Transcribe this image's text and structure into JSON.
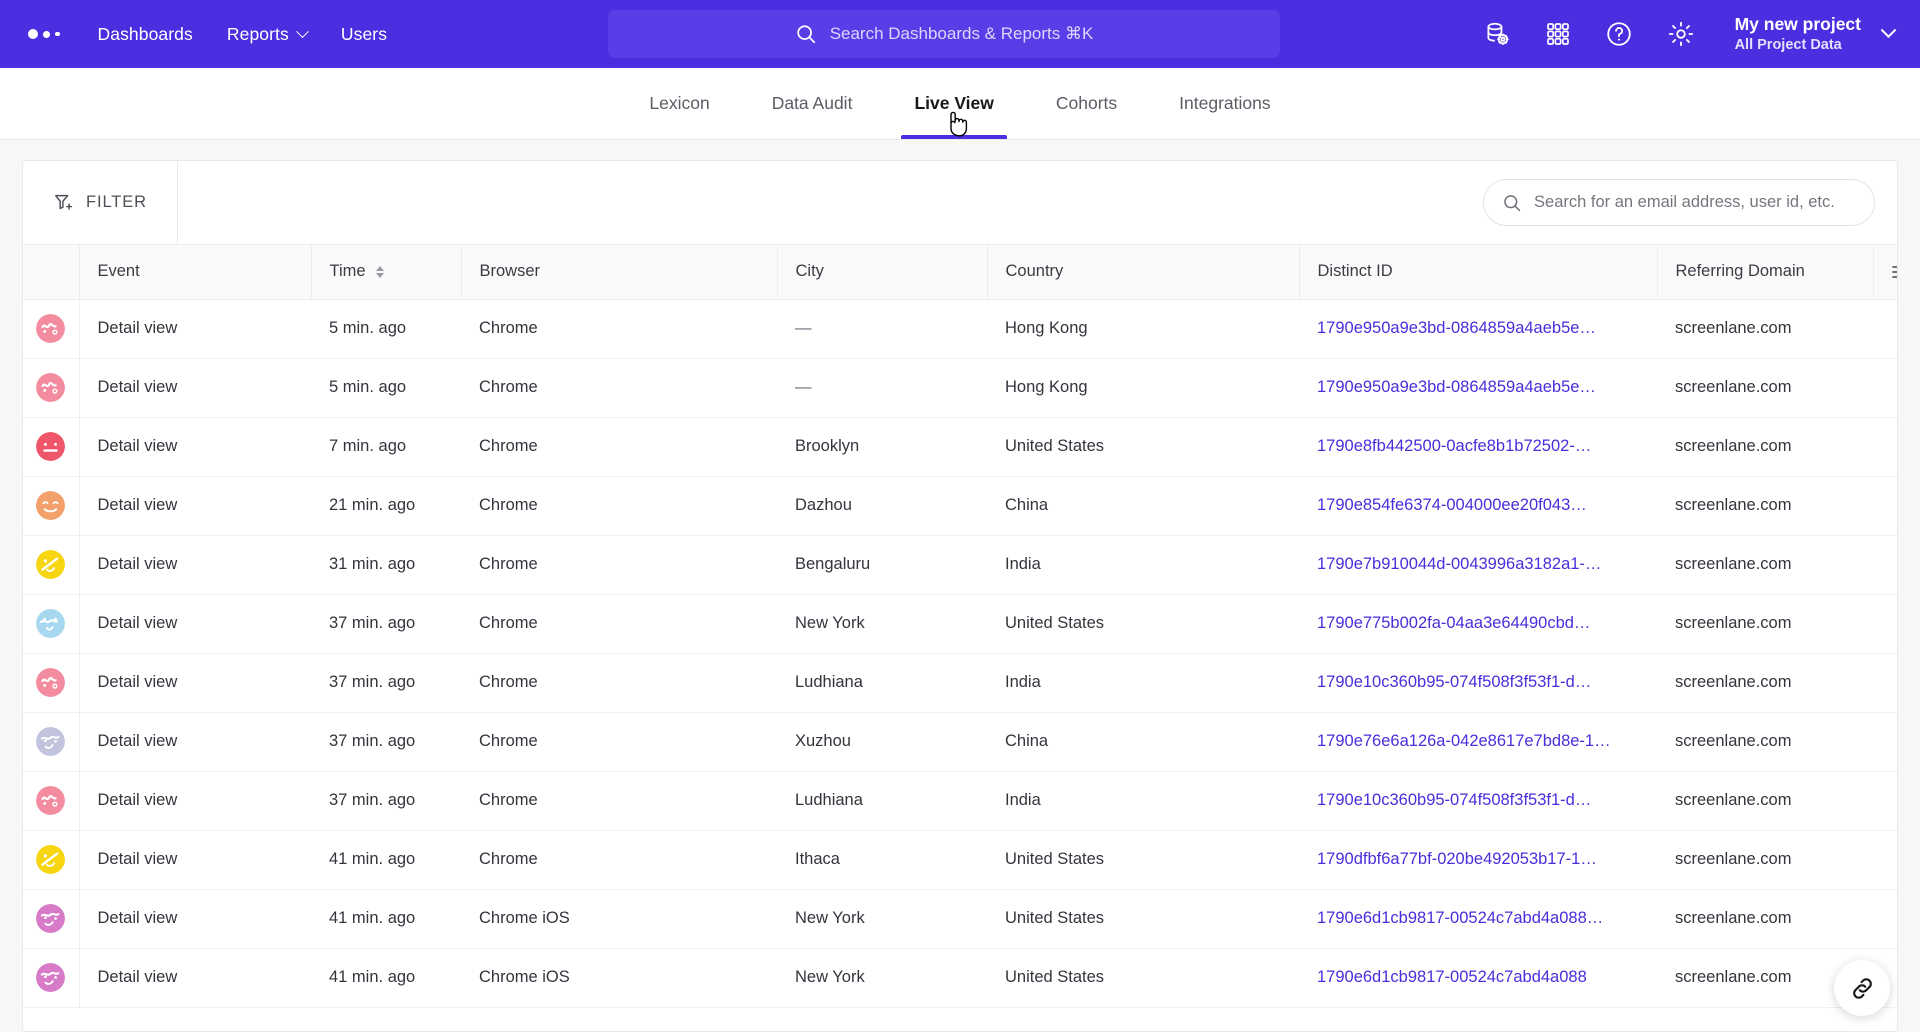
{
  "topnav": {
    "logo_name": "mixpanel-logo",
    "links": [
      {
        "label": "Dashboards",
        "has_caret": false
      },
      {
        "label": "Reports",
        "has_caret": true
      },
      {
        "label": "Users",
        "has_caret": false
      }
    ],
    "search_placeholder": "Search Dashboards & Reports ⌘K",
    "icons": [
      "database-gear-icon",
      "grid-apps-icon",
      "help-circle-icon",
      "gear-icon"
    ],
    "project": {
      "name": "My new project",
      "scope": "All Project Data"
    },
    "accent": "#4c2ee0"
  },
  "subtabs": {
    "items": [
      {
        "label": "Lexicon",
        "active": false
      },
      {
        "label": "Data Audit",
        "active": false
      },
      {
        "label": "Live View",
        "active": true
      },
      {
        "label": "Cohorts",
        "active": false
      },
      {
        "label": "Integrations",
        "active": false
      }
    ]
  },
  "toolbar": {
    "filter_label": "FILTER",
    "search_value": "",
    "search_placeholder": "Search for an email address, user id, etc."
  },
  "table": {
    "columns": [
      "Event",
      "Time",
      "Browser",
      "City",
      "Country",
      "Distinct ID",
      "Referring Domain"
    ],
    "sorted_column": "Time",
    "rows": [
      {
        "avatar": "#f48ca0",
        "event": "Detail view",
        "time": "5 min. ago",
        "browser": "Chrome",
        "city": "—",
        "country": "Hong Kong",
        "distinct_id": "1790e950a9e3bd-0864859a4aeb5e…",
        "referring_domain": "screenlane.com"
      },
      {
        "avatar": "#f48ca0",
        "event": "Detail view",
        "time": "5 min. ago",
        "browser": "Chrome",
        "city": "—",
        "country": "Hong Kong",
        "distinct_id": "1790e950a9e3bd-0864859a4aeb5e…",
        "referring_domain": "screenlane.com"
      },
      {
        "avatar": "#f0566a",
        "event": "Detail view",
        "time": "7 min. ago",
        "browser": "Chrome",
        "city": "Brooklyn",
        "country": "United States",
        "distinct_id": "1790e8fb442500-0acfe8b1b72502-…",
        "referring_domain": "screenlane.com"
      },
      {
        "avatar": "#f3a06a",
        "event": "Detail view",
        "time": "21 min. ago",
        "browser": "Chrome",
        "city": "Dazhou",
        "country": "China",
        "distinct_id": "1790e854fe6374-004000ee20f043…",
        "referring_domain": "screenlane.com"
      },
      {
        "avatar": "#f7d510",
        "event": "Detail view",
        "time": "31 min. ago",
        "browser": "Chrome",
        "city": "Bengaluru",
        "country": "India",
        "distinct_id": "1790e7b910044d-0043996a3182a1-…",
        "referring_domain": "screenlane.com"
      },
      {
        "avatar": "#a8d8ef",
        "event": "Detail view",
        "time": "37 min. ago",
        "browser": "Chrome",
        "city": "New York",
        "country": "United States",
        "distinct_id": "1790e775b002fa-04aa3e64490cbd…",
        "referring_domain": "screenlane.com"
      },
      {
        "avatar": "#f48ca0",
        "event": "Detail view",
        "time": "37 min. ago",
        "browser": "Chrome",
        "city": "Ludhiana",
        "country": "India",
        "distinct_id": "1790e10c360b95-074f508f3f53f1-d…",
        "referring_domain": "screenlane.com"
      },
      {
        "avatar": "#c2c3dd",
        "event": "Detail view",
        "time": "37 min. ago",
        "browser": "Chrome",
        "city": "Xuzhou",
        "country": "China",
        "distinct_id": "1790e76e6a126a-042e8617e7bd8e-1…",
        "referring_domain": "screenlane.com"
      },
      {
        "avatar": "#f48ca0",
        "event": "Detail view",
        "time": "37 min. ago",
        "browser": "Chrome",
        "city": "Ludhiana",
        "country": "India",
        "distinct_id": "1790e10c360b95-074f508f3f53f1-d…",
        "referring_domain": "screenlane.com"
      },
      {
        "avatar": "#f7d510",
        "event": "Detail view",
        "time": "41 min. ago",
        "browser": "Chrome",
        "city": "Ithaca",
        "country": "United States",
        "distinct_id": "1790dfbf6a77bf-020be492053b17-1…",
        "referring_domain": "screenlane.com"
      },
      {
        "avatar": "#d77ac8",
        "event": "Detail view",
        "time": "41 min. ago",
        "browser": "Chrome iOS",
        "city": "New York",
        "country": "United States",
        "distinct_id": "1790e6d1cb9817-00524c7abd4a088…",
        "referring_domain": "screenlane.com"
      },
      {
        "avatar": "#d77ac8",
        "event": "Detail view",
        "time": "41 min. ago",
        "browser": "Chrome iOS",
        "city": "New York",
        "country": "United States",
        "distinct_id": "1790e6d1cb9817-00524c7abd4a088",
        "referring_domain": "screenlane.com"
      }
    ]
  },
  "fab": {
    "icon": "link-icon"
  }
}
